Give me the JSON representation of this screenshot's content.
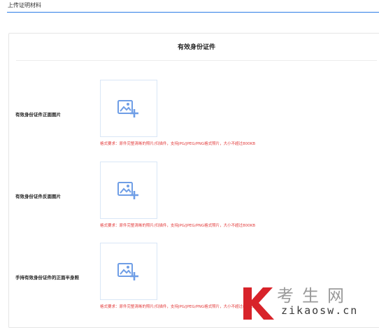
{
  "header": {
    "title": "上传证明材料"
  },
  "card": {
    "title": "有效身份证件"
  },
  "hint_text": "格式要求：原件完整清晰的照片/扫描件，支持JPG/JPEG/PNG格式照片，大小不超过800KB",
  "rows": [
    {
      "label": "有效身份证件正面图片",
      "icon": "add-image-icon"
    },
    {
      "label": "有效身份证件反面图片",
      "icon": "add-image-icon"
    },
    {
      "label": "手持有效身份证件的正面半身照",
      "icon": "add-image-icon"
    }
  ],
  "watermark": {
    "cn": "考生网",
    "url": "zikaosw.cn"
  },
  "colors": {
    "accent": "#2e7de6",
    "icon": "#6f9ee6",
    "hint": "#e23b3b",
    "brand_red": "#d8232a"
  }
}
